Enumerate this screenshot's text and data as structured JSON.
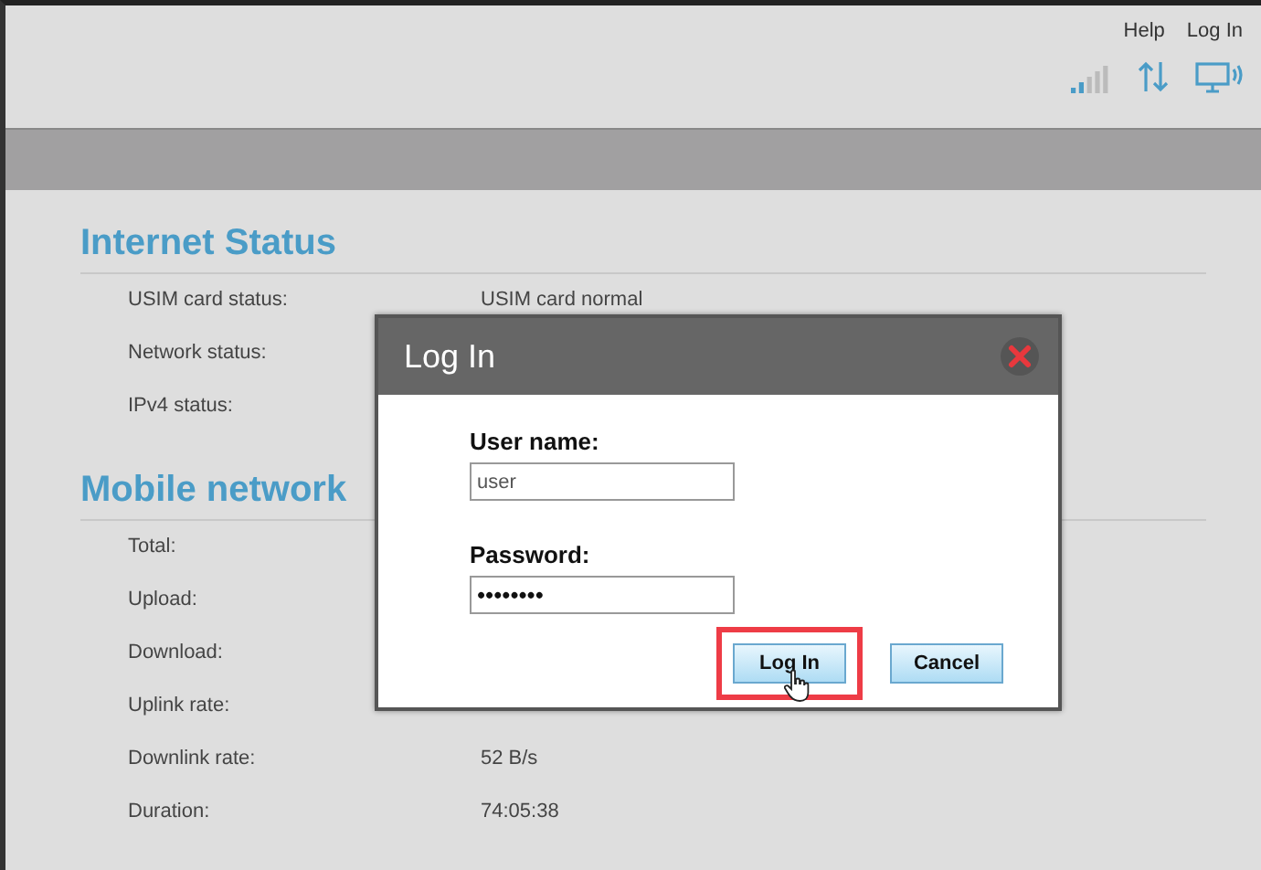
{
  "header": {
    "links": [
      "Help",
      "Log In"
    ]
  },
  "sections": [
    {
      "title": "Internet Status",
      "rows": [
        {
          "label": "USIM card status:",
          "value": "USIM card normal"
        },
        {
          "label": "Network status:"
        },
        {
          "label": "IPv4 status:"
        }
      ]
    },
    {
      "title": "Mobile network",
      "rows": [
        {
          "label": "Total:"
        },
        {
          "label": "Upload:"
        },
        {
          "label": "Download:"
        },
        {
          "label": "Uplink rate:"
        },
        {
          "label": "Downlink rate:",
          "value": "52 B/s"
        },
        {
          "label": "Duration:",
          "value": "74:05:38"
        }
      ]
    }
  ],
  "dialog": {
    "title": "Log In",
    "fields": [
      {
        "label": "User name:",
        "value": "user",
        "kind": "text"
      },
      {
        "label": "Password:",
        "value": "••••••••",
        "kind": "password"
      }
    ],
    "buttons": [
      {
        "label": "Log In",
        "highlighted": true
      },
      {
        "label": "Cancel",
        "highlighted": false
      }
    ]
  }
}
